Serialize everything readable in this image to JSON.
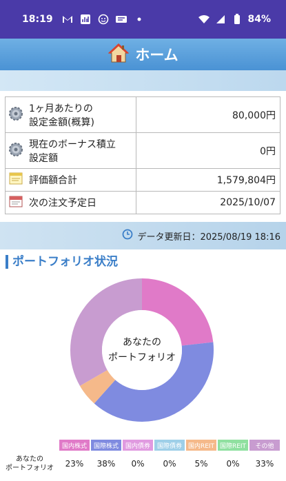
{
  "status_bar": {
    "time": "18:19",
    "battery": "84%"
  },
  "header": {
    "title": "ホーム",
    "icon": "house-icon"
  },
  "summary": {
    "rows": [
      {
        "icon": "gear-icon",
        "label_line1": "1ヶ月あたりの",
        "label_line2": "設定金額(概算)",
        "value": "80,000円"
      },
      {
        "icon": "gear-icon",
        "label_line1": "現在のボーナス積立",
        "label_line2": "設定額",
        "value": "0円"
      },
      {
        "icon": "notepad-icon",
        "label_line1": "評価額合計",
        "label_line2": "",
        "value": "1,579,804円"
      },
      {
        "icon": "calendar-icon",
        "label_line1": "次の注文予定日",
        "label_line2": "",
        "value": "2025/10/07"
      }
    ]
  },
  "update": {
    "text": "データ更新日：2025/08/19 18:16"
  },
  "portfolio": {
    "title": "ポートフォリオ状況",
    "center_line1": "あなたの",
    "center_line2": "ポートフォリオ",
    "row_label_line1": "あなたの",
    "row_label_line2": "ポートフォリオ"
  },
  "chart_data": {
    "type": "pie",
    "categories": [
      "国内株式",
      "国際株式",
      "国内債券",
      "国際債券",
      "国内REIT",
      "国際REIT",
      "その他"
    ],
    "values": [
      23,
      38,
      0,
      0,
      5,
      0,
      33
    ],
    "value_labels": [
      "23%",
      "38%",
      "0%",
      "0%",
      "5%",
      "0%",
      "33%"
    ],
    "colors": [
      "#e07ac8",
      "#7f8be0",
      "#e09ae0",
      "#9ecfe8",
      "#f5b98a",
      "#8fe0a0",
      "#c89cd0"
    ]
  }
}
